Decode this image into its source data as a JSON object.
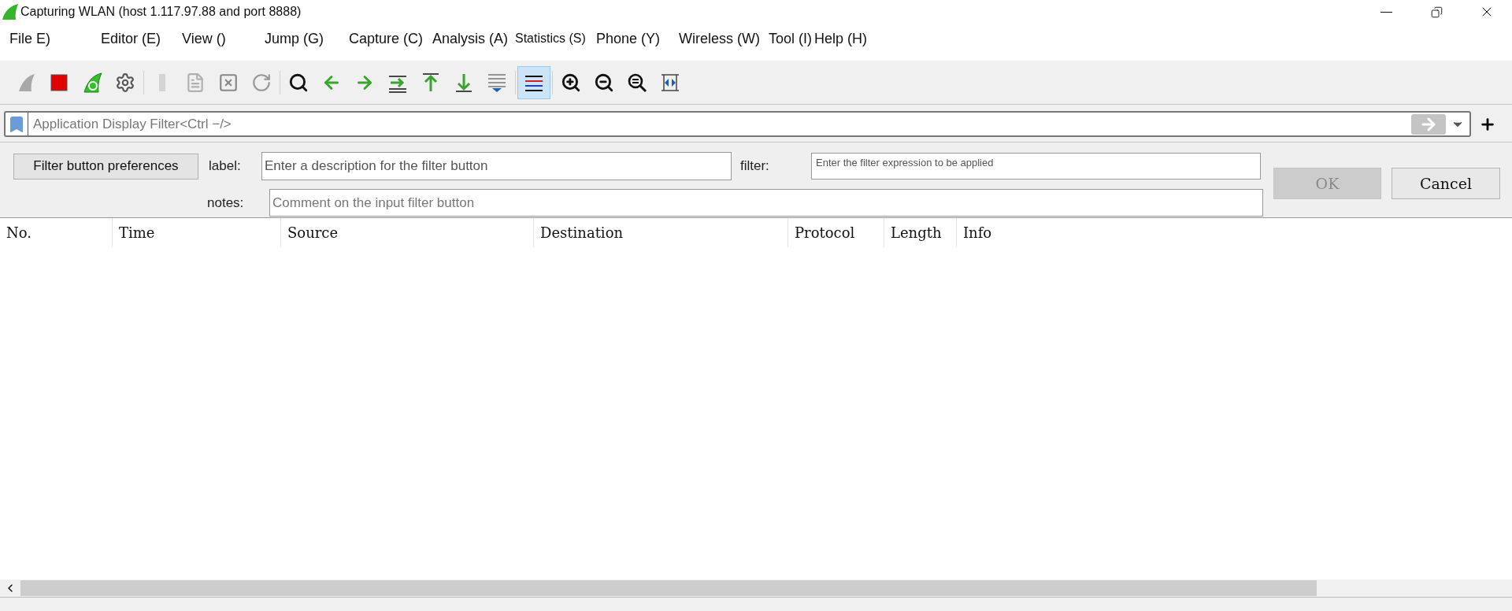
{
  "window": {
    "title": "Capturing WLAN (host 1.117.97.88 and port 8888)"
  },
  "menu": [
    "File E)",
    "Editor (E)",
    "View ()",
    "Jump (G)",
    "Capture (C)",
    "Analysis (A)",
    "Statistics (S)",
    "Phone (Y)",
    "Wireless (W)",
    "Tool (I)",
    "Help (H)"
  ],
  "toolbar": [
    {
      "disabled": true,
      "selected": false
    },
    {
      "disabled": false,
      "selected": false
    },
    {
      "disabled": false,
      "selected": false
    },
    {
      "disabled": false,
      "selected": false
    },
    {
      "disabled": true,
      "selected": false
    },
    {
      "disabled": true,
      "selected": false
    },
    {
      "disabled": true,
      "selected": false
    },
    {
      "disabled": true,
      "selected": false
    },
    {
      "disabled": false,
      "selected": false
    },
    {
      "disabled": false,
      "selected": false
    },
    {
      "disabled": false,
      "selected": false
    },
    {
      "disabled": false,
      "selected": false
    },
    {
      "disabled": false,
      "selected": false
    },
    {
      "disabled": false,
      "selected": false
    },
    {
      "disabled": false,
      "selected": false
    },
    {
      "disabled": false,
      "selected": true
    },
    {
      "disabled": false,
      "selected": false
    },
    {
      "disabled": false,
      "selected": false
    },
    {
      "disabled": false,
      "selected": false
    },
    {
      "disabled": false,
      "selected": false
    }
  ],
  "display_filter": {
    "placeholder": "Application Display Filter<Ctrl −/>"
  },
  "filter_button_preferences": {
    "button": "Filter button preferences",
    "label_caption": "label:",
    "label_placeholder": "Enter a description for the filter button",
    "filter_caption": "filter:",
    "filter_placeholder": "Enter the filter expression to be applied",
    "notes_caption": "notes:",
    "notes_placeholder": "Comment on the input filter button",
    "ok": {
      "label": "OK",
      "disabled": true
    },
    "cancel": {
      "label": "Cancel",
      "disabled": false
    }
  },
  "table": {
    "columns": [
      "No.",
      "Time",
      "Source",
      "Destination",
      "Protocol",
      "Length",
      "Info"
    ]
  }
}
